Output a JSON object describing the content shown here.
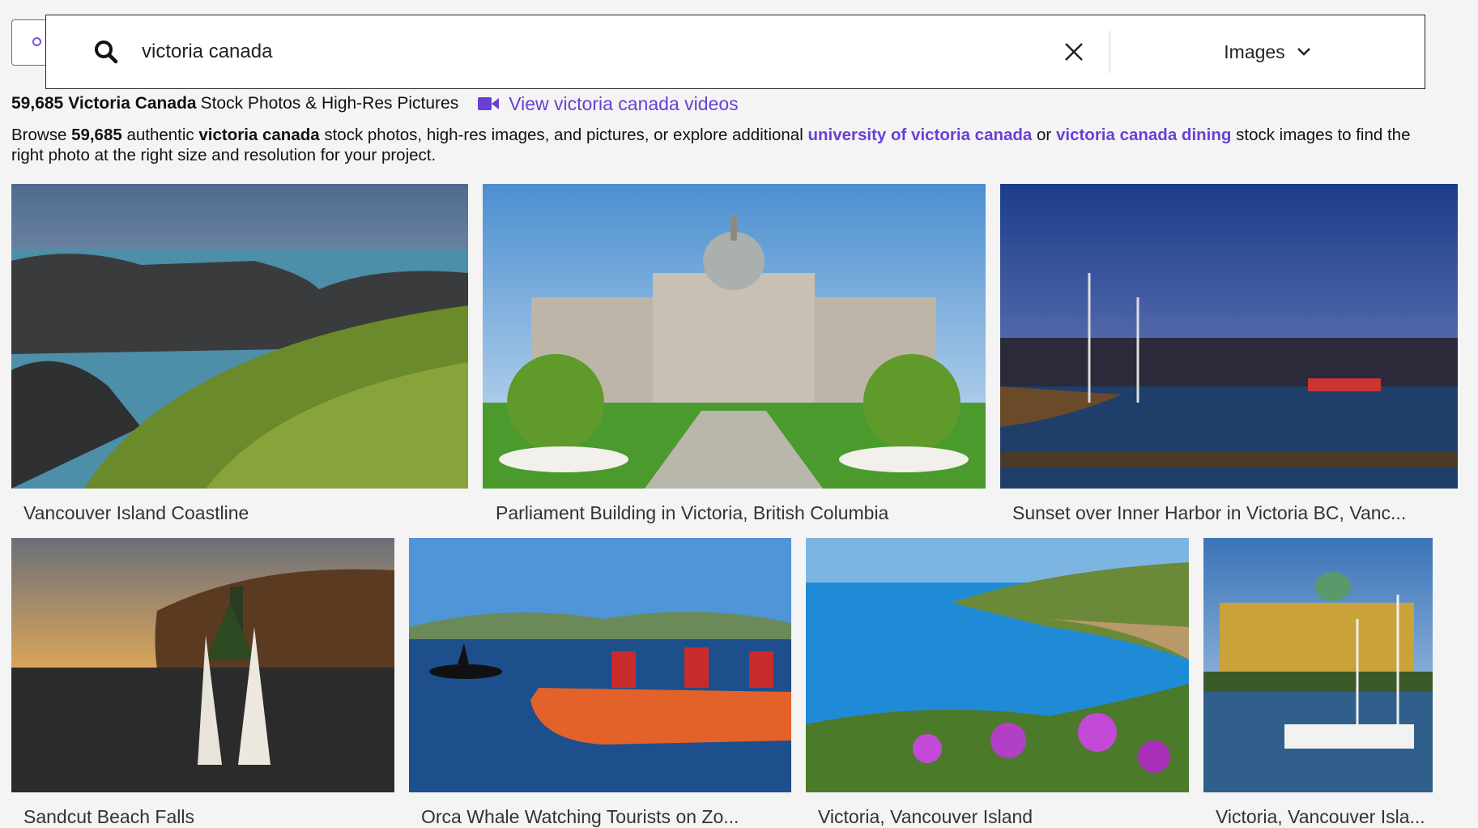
{
  "search": {
    "query": "victoria canada",
    "type_label": "Images"
  },
  "results": {
    "count": "59,685",
    "title_term": "Victoria Canada",
    "title_suffix": "Stock Photos & High-Res Pictures",
    "video_link": "View victoria canada videos"
  },
  "browse": {
    "prefix": "Browse",
    "count": "59,685",
    "authentic": "authentic",
    "term": "victoria canada",
    "middle": "stock photos, high-res images, and pictures, or explore additional",
    "link1": "university of victoria canada",
    "or": "or",
    "link2": "victoria canada dining",
    "suffix": "stock images to find the right photo at the right size and resolution for your project."
  },
  "images": [
    {
      "caption": "Vancouver Island Coastline"
    },
    {
      "caption": "Parliament Building in Victoria, British Columbia"
    },
    {
      "caption": "Sunset over Inner Harbor in Victoria BC, Vanc..."
    },
    {
      "caption": "Sandcut Beach Falls"
    },
    {
      "caption": "Orca Whale Watching Tourists on Zo..."
    },
    {
      "caption": "Victoria, Vancouver Island"
    },
    {
      "caption": "Victoria, Vancouver Isla..."
    }
  ],
  "colors": {
    "accent": "#6a3fd6",
    "background": "#f4f4f4"
  },
  "icons": [
    "search-icon",
    "close-icon",
    "chevron-down-icon",
    "video-camera-icon"
  ]
}
